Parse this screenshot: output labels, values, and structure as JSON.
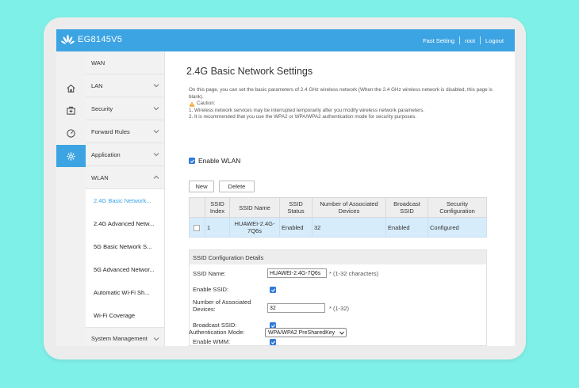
{
  "header": {
    "model": "EG8145V5",
    "links": [
      "Fast Setting",
      "root",
      "Logout"
    ]
  },
  "icon_rail": [
    "home-icon",
    "medkit-icon",
    "gauge-icon",
    "gear-icon"
  ],
  "menu": {
    "items": [
      {
        "label": "WAN"
      },
      {
        "label": "LAN"
      },
      {
        "label": "Security"
      },
      {
        "label": "Forward Rules"
      },
      {
        "label": "Application"
      },
      {
        "label": "WLAN"
      }
    ],
    "wlan_sub": [
      "2.4G Basic Network...",
      "2.4G Advanced Netw...",
      "5G Basic Network S...",
      "5G Advanced Networ...",
      "Automatic Wi-Fi Sh...",
      "Wi-Fi Coverage"
    ],
    "system_management": "System Management"
  },
  "page": {
    "title": "2.4G Basic Network Settings",
    "description": "On this page, you can set the basic parameters of 2.4 GHz wireless network (When the 2.4 GHz wireless network is disabled, this page is blank).",
    "caution_label": "Caution:",
    "caution_1": "1. Wireless network services may be interrupted temporarily after you modify wireless network parameters.",
    "caution_2": "2. It is recommended that you use the WPA2 or WPA/WPA2 authentication mode for security purposes.",
    "enable_wlan": "Enable WLAN",
    "new_button": "New",
    "delete_button": "Delete"
  },
  "ssid_table": {
    "headers": [
      "SSID Index",
      "SSID Name",
      "SSID Status",
      "Number of Associated Devices",
      "Broadcast SSID",
      "Security Configuration"
    ],
    "rows": [
      [
        "1",
        "HUAWEI-2.4G-7Q6s",
        "Enabled",
        "32",
        "Enabled",
        "Configured"
      ]
    ]
  },
  "config": {
    "heading": "SSID Configuration Details",
    "ssid_name_label": "SSID Name:",
    "ssid_name_value": "HUAWEI-2.4G-7Q6s",
    "ssid_name_hint": "* (1-32 characters)",
    "enable_ssid_label": "Enable SSID:",
    "assoc_label": "Number of Associated Devices:",
    "assoc_value": "32",
    "assoc_hint": "* (1-32)",
    "broadcast_label": "Broadcast SSID:",
    "wmm_label": "Enable WMM:",
    "auth_label": "Authentication Mode:",
    "auth_value": "WPA/WPA2 PreSharedKey"
  },
  "colors": {
    "accent": "#3da4e3",
    "background": "#7ff0e8",
    "row_highlight": "#d7ecfb"
  }
}
